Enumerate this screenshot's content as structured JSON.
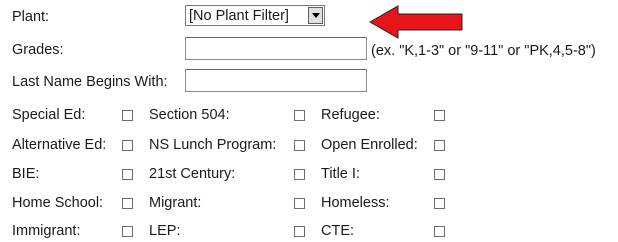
{
  "plant": {
    "label": "Plant:",
    "selected": "[No Plant Filter]"
  },
  "grades": {
    "label": "Grades:",
    "value": "",
    "hint": "(ex. \"K,1-3\" or \"9-11\" or \"PK,4,5-8\")"
  },
  "last_name": {
    "label": "Last Name Begins With:",
    "value": ""
  },
  "checkboxes": {
    "special_ed": "Special Ed:",
    "section_504": "Section 504:",
    "refugee": "Refugee:",
    "alternative_ed": "Alternative Ed:",
    "ns_lunch": "NS Lunch Program:",
    "open_enrolled": "Open Enrolled:",
    "bie": "BIE:",
    "century_21": "21st Century:",
    "title_1": "Title I:",
    "home_school": "Home School:",
    "migrant": "Migrant:",
    "homeless": "Homeless:",
    "immigrant": "Immigrant:",
    "lep": "LEP:",
    "cte": "CTE:"
  },
  "colors": {
    "arrow": "#e8141a",
    "arrow_outline": "#222222"
  }
}
